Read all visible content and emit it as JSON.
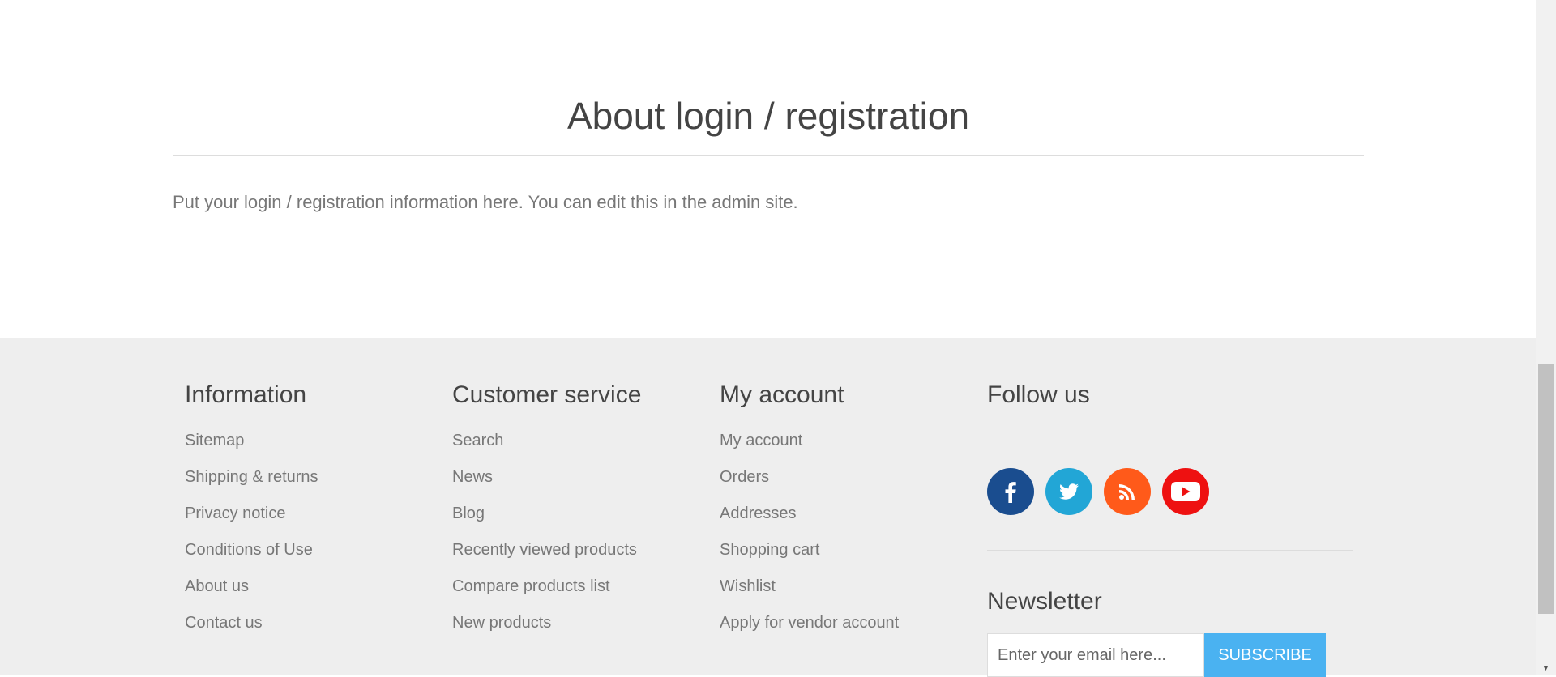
{
  "page": {
    "title": "About login / registration",
    "body": "Put your login / registration information here. You can edit this in the admin site."
  },
  "footer": {
    "information": {
      "title": "Information",
      "links": [
        "Sitemap",
        "Shipping & returns",
        "Privacy notice",
        "Conditions of Use",
        "About us",
        "Contact us"
      ]
    },
    "customer_service": {
      "title": "Customer service",
      "links": [
        "Search",
        "News",
        "Blog",
        "Recently viewed products",
        "Compare products list",
        "New products"
      ]
    },
    "my_account": {
      "title": "My account",
      "links": [
        "My account",
        "Orders",
        "Addresses",
        "Shopping cart",
        "Wishlist",
        "Apply for vendor account"
      ]
    },
    "follow_us": {
      "title": "Follow us",
      "icons": [
        "facebook-icon",
        "twitter-icon",
        "rss-icon",
        "youtube-icon"
      ],
      "colors": {
        "facebook": "#1a4d8f",
        "twitter": "#22a6d6",
        "rss": "#ff5a1a",
        "youtube": "#ee1111"
      }
    },
    "newsletter": {
      "title": "Newsletter",
      "placeholder": "Enter your email here...",
      "button": "SUBSCRIBE",
      "button_color": "#4ab2f1"
    }
  }
}
